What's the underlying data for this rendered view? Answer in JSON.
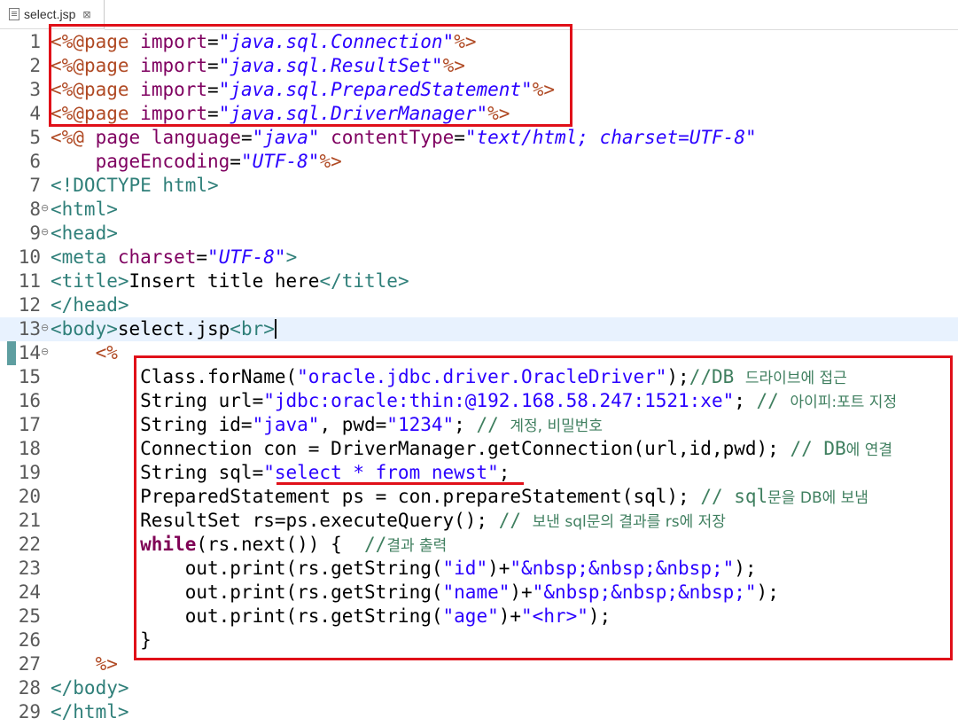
{
  "tab": {
    "label": "select.jsp",
    "close": "⊠"
  },
  "lines": [
    {
      "n": "1",
      "fold": "",
      "tokens": [
        [
          "jsp",
          "<%@"
        ],
        [
          "jsp",
          "page"
        ],
        [
          "plain",
          " "
        ],
        [
          "attr",
          "import"
        ],
        [
          "plain",
          "="
        ],
        [
          "sval",
          "\"java.sql.Connection\""
        ],
        [
          "jsp",
          "%>"
        ]
      ]
    },
    {
      "n": "2",
      "fold": "",
      "tokens": [
        [
          "jsp",
          "<%@"
        ],
        [
          "jsp",
          "page"
        ],
        [
          "plain",
          " "
        ],
        [
          "attr",
          "import"
        ],
        [
          "plain",
          "="
        ],
        [
          "sval",
          "\"java.sql.ResultSet\""
        ],
        [
          "jsp",
          "%>"
        ]
      ]
    },
    {
      "n": "3",
      "fold": "",
      "tokens": [
        [
          "jsp",
          "<%@"
        ],
        [
          "jsp",
          "page"
        ],
        [
          "plain",
          " "
        ],
        [
          "attr",
          "import"
        ],
        [
          "plain",
          "="
        ],
        [
          "sval",
          "\"java.sql.PreparedStatement\""
        ],
        [
          "jsp",
          "%>"
        ]
      ]
    },
    {
      "n": "4",
      "fold": "",
      "tokens": [
        [
          "jsp",
          "<%@"
        ],
        [
          "jsp",
          "page"
        ],
        [
          "plain",
          " "
        ],
        [
          "attr",
          "import"
        ],
        [
          "plain",
          "="
        ],
        [
          "sval",
          "\"java.sql.DriverManager\""
        ],
        [
          "jsp",
          "%>"
        ]
      ]
    },
    {
      "n": "5",
      "fold": "",
      "tokens": [
        [
          "jsp",
          "<%@"
        ],
        [
          "plain",
          " "
        ],
        [
          "attr",
          "page"
        ],
        [
          "plain",
          " "
        ],
        [
          "attr",
          "language"
        ],
        [
          "plain",
          "="
        ],
        [
          "sval",
          "\"java\""
        ],
        [
          "plain",
          " "
        ],
        [
          "attr",
          "contentType"
        ],
        [
          "plain",
          "="
        ],
        [
          "sval",
          "\"text/html; charset=UTF-8\""
        ]
      ]
    },
    {
      "n": "6",
      "fold": "",
      "tokens": [
        [
          "plain",
          "    "
        ],
        [
          "attr",
          "pageEncoding"
        ],
        [
          "plain",
          "="
        ],
        [
          "sval",
          "\"UTF-8\""
        ],
        [
          "jsp",
          "%>"
        ]
      ]
    },
    {
      "n": "7",
      "fold": "",
      "tokens": [
        [
          "tag",
          "<!DOCTYPE html>"
        ]
      ]
    },
    {
      "n": "8",
      "fold": "⊖",
      "tokens": [
        [
          "tag",
          "<html>"
        ]
      ]
    },
    {
      "n": "9",
      "fold": "⊖",
      "tokens": [
        [
          "tag",
          "<head>"
        ]
      ]
    },
    {
      "n": "10",
      "fold": "",
      "tokens": [
        [
          "tag",
          "<meta"
        ],
        [
          "plain",
          " "
        ],
        [
          "attr",
          "charset"
        ],
        [
          "plain",
          "="
        ],
        [
          "sval",
          "\"UTF-8\""
        ],
        [
          "tag",
          ">"
        ]
      ]
    },
    {
      "n": "11",
      "fold": "",
      "tokens": [
        [
          "tag",
          "<title>"
        ],
        [
          "plain",
          "Insert title here"
        ],
        [
          "tag",
          "</title>"
        ]
      ]
    },
    {
      "n": "12",
      "fold": "",
      "tokens": [
        [
          "tag",
          "</head>"
        ]
      ]
    },
    {
      "n": "13",
      "fold": "⊖",
      "current": true,
      "caret": true,
      "tokens": [
        [
          "tag",
          "<body>"
        ],
        [
          "plain",
          "select.jsp"
        ],
        [
          "tag",
          "<br>"
        ]
      ]
    },
    {
      "n": "14",
      "fold": "⊖",
      "tokens": [
        [
          "plain",
          "    "
        ],
        [
          "jsp",
          "<%"
        ]
      ]
    },
    {
      "n": "15",
      "fold": "",
      "tokens": [
        [
          "plain",
          "        Class.forName("
        ],
        [
          "str",
          "\"oracle.jdbc.driver.OracleDriver\""
        ],
        [
          "plain",
          ");"
        ],
        [
          "cmt",
          "//DB "
        ],
        [
          "cmtk",
          "드라이브에 접근"
        ]
      ]
    },
    {
      "n": "16",
      "fold": "",
      "tokens": [
        [
          "plain",
          "        String url="
        ],
        [
          "str",
          "\"jdbc:oracle:thin:@192.168.58.247:1521:xe\""
        ],
        [
          "plain",
          "; "
        ],
        [
          "cmt",
          "// "
        ],
        [
          "cmtk",
          "아이피:포트 지정"
        ]
      ]
    },
    {
      "n": "17",
      "fold": "",
      "tokens": [
        [
          "plain",
          "        String id="
        ],
        [
          "str",
          "\"java\""
        ],
        [
          "plain",
          ", pwd="
        ],
        [
          "str",
          "\"1234\""
        ],
        [
          "plain",
          "; "
        ],
        [
          "cmt",
          "// "
        ],
        [
          "cmtk",
          "계정, 비밀번호"
        ]
      ]
    },
    {
      "n": "18",
      "fold": "",
      "tokens": [
        [
          "plain",
          "        Connection con = DriverManager.getConnection(url,id,pwd); "
        ],
        [
          "cmt",
          "// DB"
        ],
        [
          "cmtk",
          "에 연결"
        ]
      ]
    },
    {
      "n": "19",
      "fold": "",
      "tokens": [
        [
          "plain",
          "        String sql="
        ],
        [
          "str",
          "\"select * from newst\""
        ],
        [
          "plain",
          ";"
        ]
      ]
    },
    {
      "n": "20",
      "fold": "",
      "tokens": [
        [
          "plain",
          "        PreparedStatement ps = con.prepareStatement(sql); "
        ],
        [
          "cmt",
          "// sql"
        ],
        [
          "cmtk",
          "문을 DB에 보냄"
        ]
      ]
    },
    {
      "n": "21",
      "fold": "",
      "tokens": [
        [
          "plain",
          "        ResultSet rs=ps.executeQuery(); "
        ],
        [
          "cmt",
          "// "
        ],
        [
          "cmtk",
          "보낸 sql문의 결과를 rs에 저장"
        ]
      ]
    },
    {
      "n": "22",
      "fold": "",
      "tokens": [
        [
          "kw",
          "        while"
        ],
        [
          "plain",
          "(rs.next()) {  "
        ],
        [
          "cmt",
          "//"
        ],
        [
          "cmtk",
          "결과 출력"
        ]
      ]
    },
    {
      "n": "23",
      "fold": "",
      "tokens": [
        [
          "plain",
          "            out.print(rs.getString("
        ],
        [
          "str",
          "\"id\""
        ],
        [
          "plain",
          ")+"
        ],
        [
          "str",
          "\"&nbsp;&nbsp;&nbsp;\""
        ],
        [
          "plain",
          ");"
        ]
      ]
    },
    {
      "n": "24",
      "fold": "",
      "tokens": [
        [
          "plain",
          "            out.print(rs.getString("
        ],
        [
          "str",
          "\"name\""
        ],
        [
          "plain",
          ")+"
        ],
        [
          "str",
          "\"&nbsp;&nbsp;&nbsp;\""
        ],
        [
          "plain",
          ");"
        ]
      ]
    },
    {
      "n": "25",
      "fold": "",
      "tokens": [
        [
          "plain",
          "            out.print(rs.getString("
        ],
        [
          "str",
          "\"age\""
        ],
        [
          "plain",
          ")+"
        ],
        [
          "str",
          "\"<hr>\""
        ],
        [
          "plain",
          ");"
        ]
      ]
    },
    {
      "n": "26",
      "fold": "",
      "tokens": [
        [
          "plain",
          "        }"
        ]
      ]
    },
    {
      "n": "27",
      "fold": "",
      "tokens": [
        [
          "plain",
          "    "
        ],
        [
          "jsp",
          "%>"
        ]
      ]
    },
    {
      "n": "28",
      "fold": "",
      "tokens": [
        [
          "tag",
          "</body>"
        ]
      ]
    },
    {
      "n": "29",
      "fold": "",
      "tokens": [
        [
          "tag",
          "</html>"
        ]
      ]
    }
  ],
  "colors": {
    "highlight": "#e01019",
    "current_line": "#e8f2fe"
  }
}
